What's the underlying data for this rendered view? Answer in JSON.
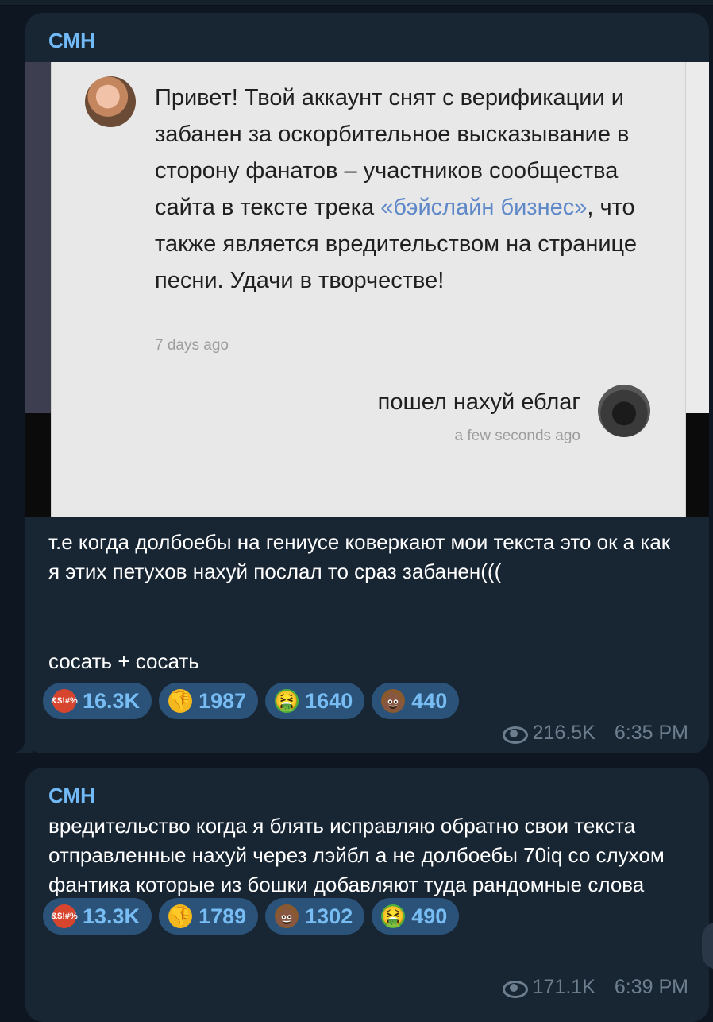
{
  "messages": [
    {
      "author": "СМН",
      "screenshot": {
        "text_before_link": "Привет! Твой аккаунт снят с верификации и забанен за оскорбительное высказывание в сторону фанатов – участников сообщества сайта в тексте трека ",
        "link": "«бэйслайн бизнес»",
        "text_after_link": ", что также является вредительством на странице песни. Удачи в творчестве!",
        "timestamp": "7 days ago",
        "reply": "пошел нахуй еблаг",
        "reply_timestamp": "a few seconds ago"
      },
      "caption_1": "т.е когда долбоебы на гениусе коверкают мои текста это ок а как я этих петухов нахуй послал то сраз забанен(((",
      "caption_2": "сосать + сосать",
      "reactions": [
        {
          "emoji": "angry-face-icon",
          "glyph": "&$!#%",
          "count": "16.3K"
        },
        {
          "emoji": "thumbs-down-icon",
          "glyph": "👎",
          "count": "1987"
        },
        {
          "emoji": "vomit-face-icon",
          "glyph": "🤮",
          "count": "1640"
        },
        {
          "emoji": "poop-icon",
          "glyph": "💩",
          "count": "440"
        }
      ],
      "views": "216.5K",
      "time": "6:35 PM"
    },
    {
      "author": "СМН",
      "text": "вредительство когда я блять исправляю обратно свои текста отправленные нахуй через лэйбл а не долбоебы 70iq со слухом фантика которые из бошки добавляют туда рандомные слова",
      "reactions": [
        {
          "emoji": "angry-face-icon",
          "glyph": "&$!#%",
          "count": "13.3K"
        },
        {
          "emoji": "thumbs-down-icon",
          "glyph": "👎",
          "count": "1789"
        },
        {
          "emoji": "poop-icon",
          "glyph": "💩",
          "count": "1302"
        },
        {
          "emoji": "vomit-face-icon",
          "glyph": "🤮",
          "count": "490"
        }
      ],
      "views": "171.1K",
      "time": "6:39 PM"
    }
  ],
  "colors": {
    "background": "#0e1621",
    "bubble": "#182533",
    "author": "#71baf7",
    "reaction_bg": "#2b5278",
    "reaction_text": "#77bcf3",
    "meta": "#6d7f8f",
    "link": "#5f88c8"
  }
}
